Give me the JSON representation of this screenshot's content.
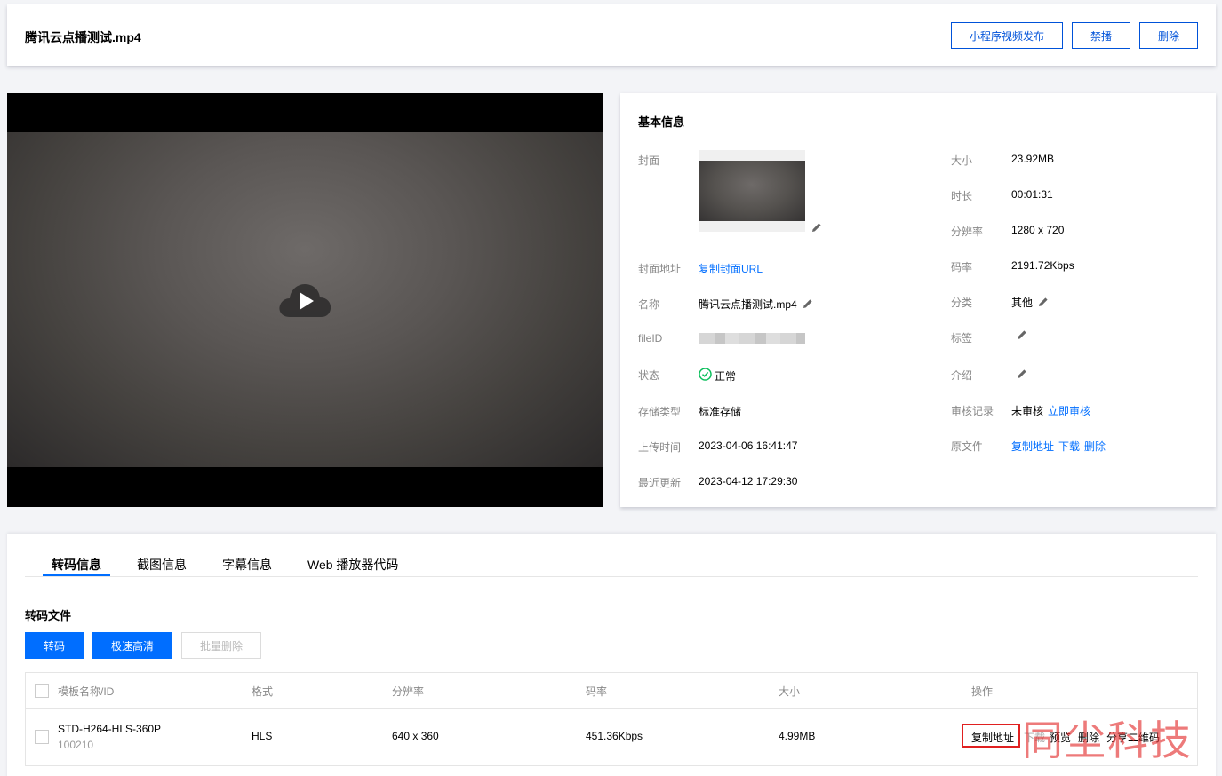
{
  "header": {
    "title": "腾讯云点播测试.mp4",
    "buttons": {
      "publish": "小程序视频发布",
      "ban": "禁播",
      "delete": "删除"
    }
  },
  "basic_info": {
    "section_title": "基本信息",
    "left": {
      "cover_label": "封面",
      "cover_url_label": "封面地址",
      "cover_url_value": "复制封面URL",
      "name_label": "名称",
      "name_value": "腾讯云点播测试.mp4",
      "fileid_label": "fileID",
      "status_label": "状态",
      "status_value": "正常",
      "storage_label": "存储类型",
      "storage_value": "标准存储",
      "upload_label": "上传时间",
      "upload_value": "2023-04-06 16:41:47",
      "updated_label": "最近更新",
      "updated_value": "2023-04-12 17:29:30"
    },
    "right": {
      "size_label": "大小",
      "size_value": "23.92MB",
      "duration_label": "时长",
      "duration_value": "00:01:31",
      "resolution_label": "分辨率",
      "resolution_value": "1280 x 720",
      "bitrate_label": "码率",
      "bitrate_value": "2191.72Kbps",
      "category_label": "分类",
      "category_value": "其他",
      "tags_label": "标签",
      "intro_label": "介绍",
      "review_label": "审核记录",
      "review_value": "未审核",
      "review_link": "立即审核",
      "source_label": "原文件",
      "source_copy": "复制地址",
      "source_download": "下载",
      "source_delete": "删除"
    }
  },
  "tabs": [
    "转码信息",
    "截图信息",
    "字幕信息",
    "Web 播放器代码"
  ],
  "transcode": {
    "section_title": "转码文件",
    "btn_transcode": "转码",
    "btn_turbo": "极速高清",
    "btn_batch_delete": "批量删除",
    "columns": [
      "模板名称/ID",
      "格式",
      "分辨率",
      "码率",
      "大小",
      "操作"
    ],
    "row": {
      "template_name": "STD-H264-HLS-360P",
      "template_id": "100210",
      "format": "HLS",
      "resolution": "640 x 360",
      "bitrate": "451.36Kbps",
      "size": "4.99MB",
      "actions": {
        "copy": "复制地址",
        "download": "下载",
        "preview": "预览",
        "delete": "删除",
        "share": "分享二维码"
      }
    }
  },
  "watermark": "同尘科技",
  "colors": {
    "accent": "#006eff",
    "success": "#0abf5b",
    "highlight_box": "#e02020"
  }
}
